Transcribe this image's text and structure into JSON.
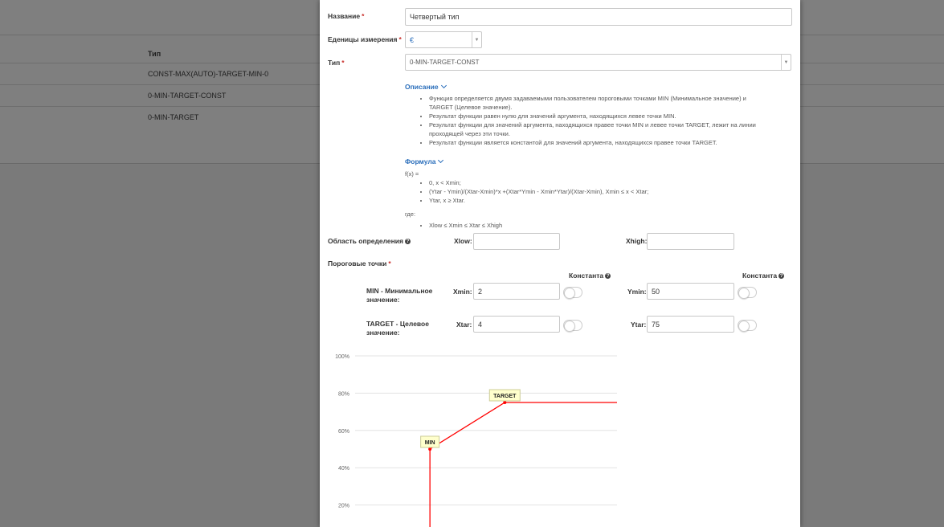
{
  "background": {
    "table_header": "Тип",
    "rows": [
      "CONST-MAX(AUTO)-TARGET-MIN-0",
      "0-MIN-TARGET-CONST",
      "0-MIN-TARGET"
    ]
  },
  "form": {
    "name_label": "Название",
    "name_value": "Четвертый тип",
    "unit_label": "Еденицы измерения",
    "unit_value": "€",
    "type_label": "Тип",
    "type_value": "0-MIN-TARGET-CONST",
    "required_mark": "*"
  },
  "description": {
    "toggle_label": "Описание",
    "items": [
      "Функция определяется двумя задаваемыми пользователем пороговыми точками MIN (Минимальное значение) и TARGET (Целевое значение).",
      "Результат функции равен нулю для значений аргумента, находящихся левее точки MIN.",
      "Результат функции для значений аргумента, находящихся правее точки MIN и левее точки TARGET, лежит на линии проходящей через эти точки.",
      "Результат функции является константой для значений аргумента, находящихся правее точки TARGET."
    ]
  },
  "formula": {
    "toggle_label": "Формула",
    "fx": "f(x) =",
    "items": [
      "0, x < Xmin;",
      "(Ytar - Ymin)/(Xtar-Xmin)*x +(Xtar*Ymin - Xmin*Ytar)/(Xtar-Xmin), Xmin ≤ x < Xtar;",
      "Ytar, x ≥ Xtar."
    ],
    "where": "где:",
    "where_items": [
      "Xlow ≤ Xmin ≤ Xtar ≤ Xhigh"
    ]
  },
  "domain": {
    "label": "Область определения",
    "help": "?",
    "xlow_label": "Xlow:",
    "xlow_value": "",
    "xhigh_label": "Xhigh:",
    "xhigh_value": ""
  },
  "thresholds": {
    "label": "Пороговые точки",
    "constant_label": "Константа",
    "min_label": "MIN - Минимальное значение:",
    "xmin_label": "Xmin:",
    "xmin_value": "2",
    "ymin_label": "Ymin:",
    "ymin_value": "50",
    "target_label": "TARGET - Целевое значение:",
    "xtar_label": "Xtar:",
    "xtar_value": "4",
    "ytar_label": "Ytar:",
    "ytar_value": "75"
  },
  "chart_data": {
    "type": "line",
    "y_ticks": [
      "100%",
      "80%",
      "60%",
      "40%",
      "20%"
    ],
    "y_tick_values": [
      100,
      80,
      60,
      40,
      20
    ],
    "ylim": [
      0,
      100
    ],
    "xlim": [
      0,
      7
    ],
    "points": [
      {
        "x": 2,
        "y": 0
      },
      {
        "x": 2,
        "y": 50
      },
      {
        "x": 4,
        "y": 75
      },
      {
        "x": 7,
        "y": 75
      }
    ],
    "annotations": [
      {
        "label": "MIN",
        "x": 2,
        "y": 50
      },
      {
        "label": "TARGET",
        "x": 4,
        "y": 75
      }
    ],
    "line_color": "#ff0000",
    "grid": true
  }
}
